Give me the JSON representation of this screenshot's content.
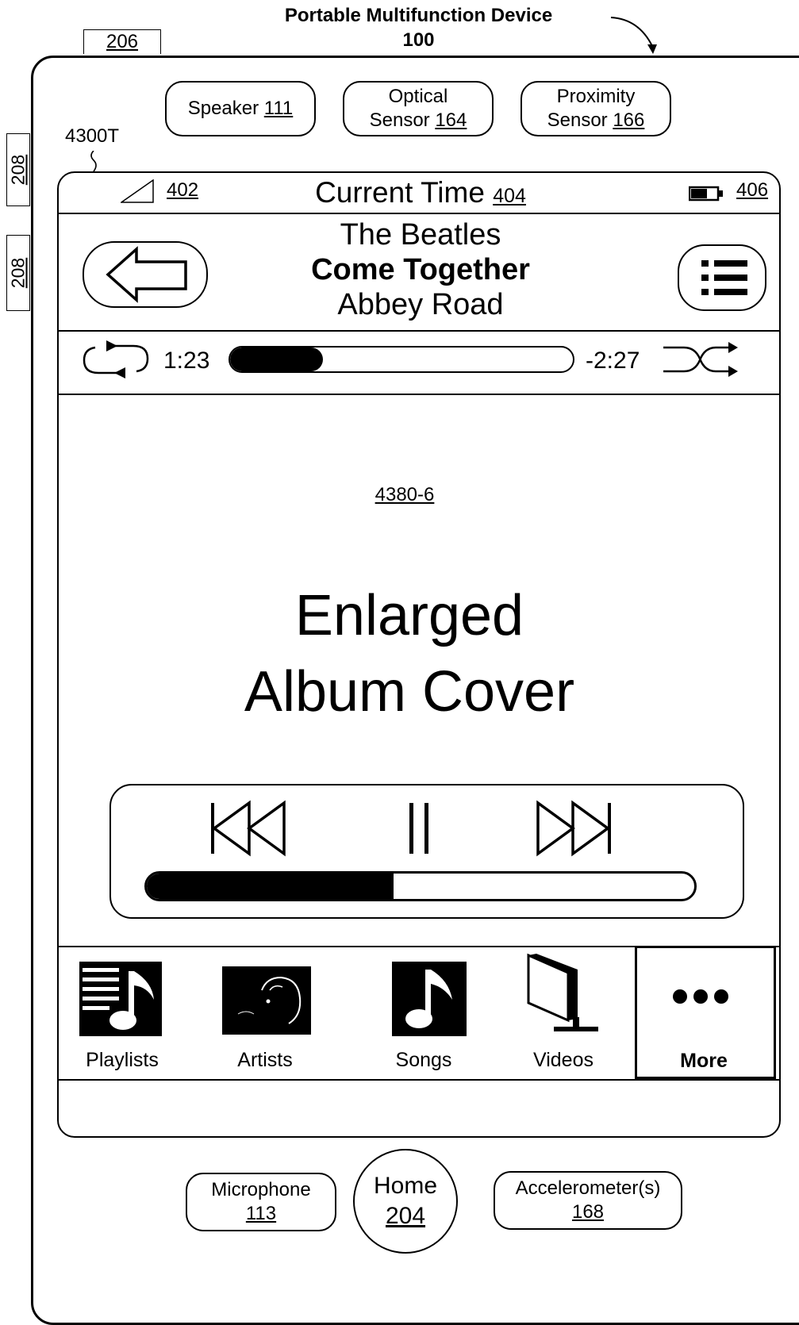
{
  "title": {
    "line1": "Portable Multifunction Device",
    "line2": "100"
  },
  "refs": {
    "r206": "206",
    "r208a": "208",
    "r208b": "208",
    "r4300t": "4300T"
  },
  "sensors": {
    "speaker": {
      "label": "Speaker",
      "ref": "111"
    },
    "optical": {
      "label1": "Optical",
      "label2": "Sensor",
      "ref": "164"
    },
    "proximity": {
      "label1": "Proximity",
      "label2": "Sensor",
      "ref": "166"
    }
  },
  "status_bar": {
    "signal_ref": "402",
    "time_label": "Current Time",
    "time_ref": "404",
    "battery_ref": "406"
  },
  "now_playing": {
    "artist": "The Beatles",
    "song": "Come Together",
    "album": "Abbey Road"
  },
  "scrubber": {
    "elapsed": "1:23",
    "remaining": "-2:27",
    "progress": 0.27
  },
  "album_cover": {
    "ref": "4380-6",
    "line1": "Enlarged",
    "line2": "Album Cover"
  },
  "volume": {
    "level": 0.45
  },
  "tabs": [
    {
      "label": "Playlists",
      "icon": "playlists-icon"
    },
    {
      "label": "Artists",
      "icon": "artists-icon"
    },
    {
      "label": "Songs",
      "icon": "songs-icon"
    },
    {
      "label": "Videos",
      "icon": "videos-icon"
    },
    {
      "label": "More",
      "icon": "more-icon"
    }
  ],
  "bottom": {
    "microphone": {
      "label": "Microphone",
      "ref": "113"
    },
    "home": {
      "label": "Home",
      "ref": "204"
    },
    "accelerometer": {
      "label": "Accelerometer(s)",
      "ref": "168"
    }
  }
}
